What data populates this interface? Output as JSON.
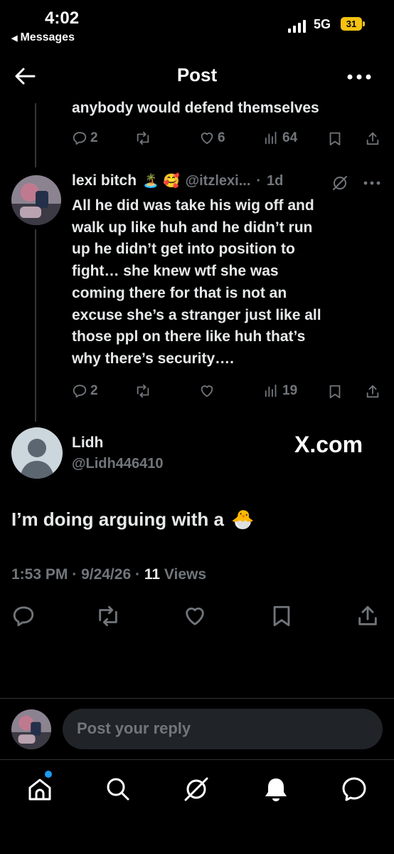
{
  "status_bar": {
    "time": "4:02",
    "back_label": "Messages",
    "network": "5G",
    "battery": "31"
  },
  "header": {
    "title": "Post"
  },
  "prev_tweet": {
    "text_tail": "anybody would defend themselves",
    "actions": {
      "replies": "2",
      "reposts": "",
      "likes": "6",
      "views": "64"
    }
  },
  "reply_tweet": {
    "name": "lexi bitch",
    "emojis": "🏝️ 🥰",
    "handle": "@itzlexi...",
    "separator": "·",
    "time": "1d",
    "text_lines": [
      "All he did was take his wig off and",
      "walk up like huh and he didn’t run",
      "up he didn’t get into position to",
      "fight… she knew wtf she was",
      "coming there for that is not an",
      "excuse she’s a stranger just like all",
      "those ppl on there like huh that’s",
      "why there’s security…."
    ],
    "actions": {
      "replies": "2",
      "reposts": "",
      "likes": "",
      "views": "19"
    }
  },
  "main_tweet": {
    "name": "Lidh",
    "handle": "@Lidh446410",
    "watermark": "X.com",
    "text": "I’m doing arguing with a",
    "emoji": "🐣",
    "meta_time": "1:53 PM",
    "meta_sep1": "·",
    "meta_date": "9/24/26",
    "meta_sep2": "·",
    "meta_views_count": "11",
    "meta_views_label": "Views"
  },
  "reply_composer": {
    "placeholder": "Post your reply"
  },
  "bottom_nav": {
    "items": [
      "home",
      "search",
      "grok",
      "notifications",
      "messages"
    ]
  },
  "colors": {
    "accent": "#1d9bf0",
    "muted": "#71767b",
    "text": "#e7e9ea",
    "battery": "#f5c211"
  }
}
